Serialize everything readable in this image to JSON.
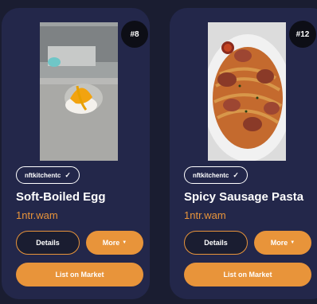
{
  "cards": [
    {
      "badge": "#8",
      "collection": "nftkitchentc",
      "title": "Soft-Boiled Egg",
      "owner": "1ntr.wam",
      "details_label": "Details",
      "more_label": "More",
      "market_label": "List on Market",
      "image_icon": "soft-boiled-egg-photo"
    },
    {
      "badge": "#12",
      "collection": "nftkitchentc",
      "title": "Spicy Sausage Pasta",
      "owner": "1ntr.wam",
      "details_label": "Details",
      "more_label": "More",
      "market_label": "List on Market",
      "image_icon": "sausage-pasta-photo"
    }
  ],
  "colors": {
    "background": "#1a1d31",
    "card": "#23274a",
    "accent": "#e8943a",
    "badge": "#0d0e16"
  }
}
